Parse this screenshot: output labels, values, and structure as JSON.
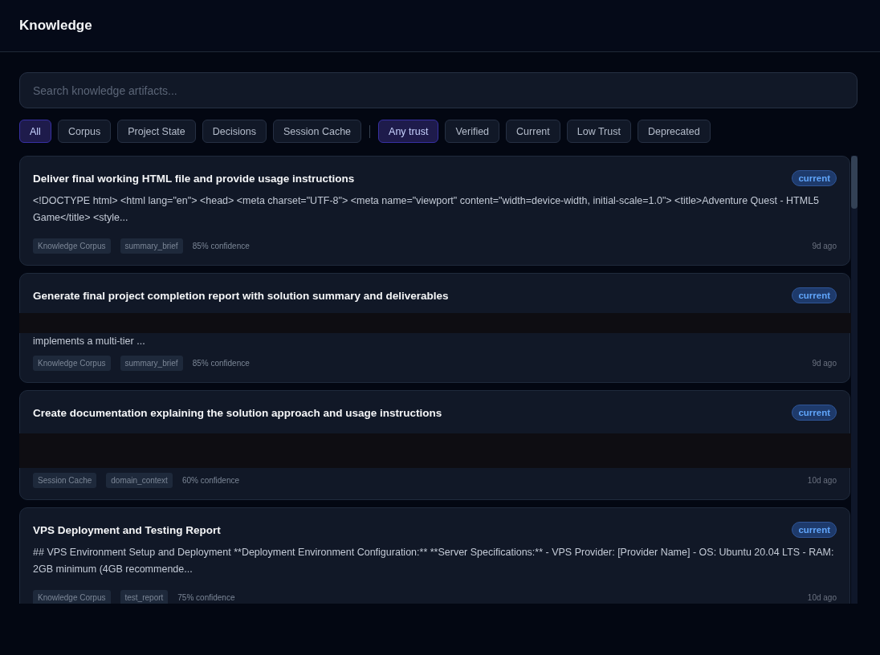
{
  "header": {
    "title": "Knowledge"
  },
  "search": {
    "placeholder": "Search knowledge artifacts..."
  },
  "type_filters": [
    {
      "label": "All",
      "selected": true
    },
    {
      "label": "Corpus",
      "selected": false
    },
    {
      "label": "Project State",
      "selected": false
    },
    {
      "label": "Decisions",
      "selected": false
    },
    {
      "label": "Session Cache",
      "selected": false
    }
  ],
  "trust_filters": [
    {
      "label": "Any trust",
      "selected": true
    },
    {
      "label": "Verified",
      "selected": false
    },
    {
      "label": "Current",
      "selected": false
    },
    {
      "label": "Low Trust",
      "selected": false
    },
    {
      "label": "Deprecated",
      "selected": false
    }
  ],
  "artifacts": [
    {
      "title": "Deliver final working HTML file and provide usage instructions",
      "status": "current",
      "redacted": false,
      "summary": "<!DOCTYPE html> <html lang=\"en\"> <head> <meta charset=\"UTF-8\"> <meta name=\"viewport\" content=\"width=device-width, initial-scale=1.0\"> <title>Adventure Quest - HTML5 Game</title> <style...",
      "source": "Knowledge Corpus",
      "category": "summary_brief",
      "confidence": "85% confidence",
      "age": "9d ago"
    },
    {
      "title": "Generate final project completion report with solution summary and deliverables",
      "status": "current",
      "redacted": true,
      "summary": "implements a multi-tier ...",
      "source": "Knowledge Corpus",
      "category": "summary_brief",
      "confidence": "85% confidence",
      "age": "9d ago"
    },
    {
      "title": "Create documentation explaining the solution approach and usage instructions",
      "status": "current",
      "redacted": true,
      "source": "Session Cache",
      "category": "domain_context",
      "confidence": "60% confidence",
      "age": "10d ago"
    },
    {
      "title": "VPS Deployment and Testing Report",
      "status": "current",
      "redacted": false,
      "summary": "## VPS Environment Setup and Deployment **Deployment Environment Configuration:** **Server Specifications:** - VPS Provider: [Provider Name] - OS: Ubuntu 20.04 LTS - RAM: 2GB minimum (4GB recommende...",
      "source": "Knowledge Corpus",
      "category": "test_report",
      "confidence": "75% confidence",
      "age": "10d ago"
    }
  ]
}
